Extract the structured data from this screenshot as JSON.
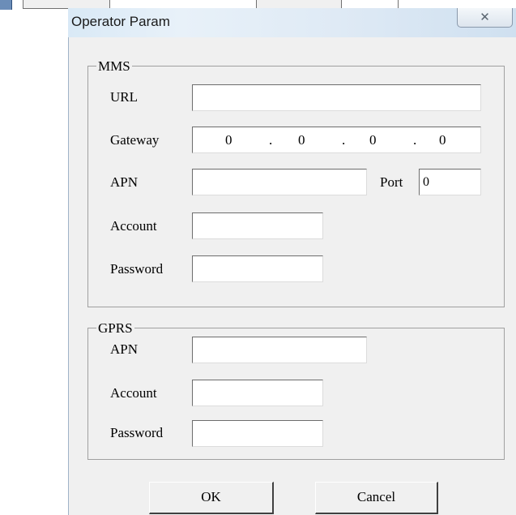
{
  "dialog": {
    "title": "Operator Param",
    "close_icon": "close-x-icon",
    "close_glyph": "✕"
  },
  "mms": {
    "label": "MMS",
    "url_label": "URL",
    "url_value": "",
    "gateway_label": "Gateway",
    "gateway_octets": [
      "0",
      "0",
      "0",
      "0"
    ],
    "gateway_dot": ".",
    "apn_label": "APN",
    "apn_value": "",
    "port_label": "Port",
    "port_value": "0",
    "account_label": "Account",
    "account_value": "",
    "password_label": "Password",
    "password_value": ""
  },
  "gprs": {
    "label": "GPRS",
    "apn_label": "APN",
    "apn_value": "",
    "account_label": "Account",
    "account_value": "",
    "password_label": "Password",
    "password_value": ""
  },
  "buttons": {
    "ok": "OK",
    "cancel": "Cancel"
  },
  "colors": {
    "client_bg": "#f0f0f0",
    "titlebar": "#dfeaf5"
  }
}
